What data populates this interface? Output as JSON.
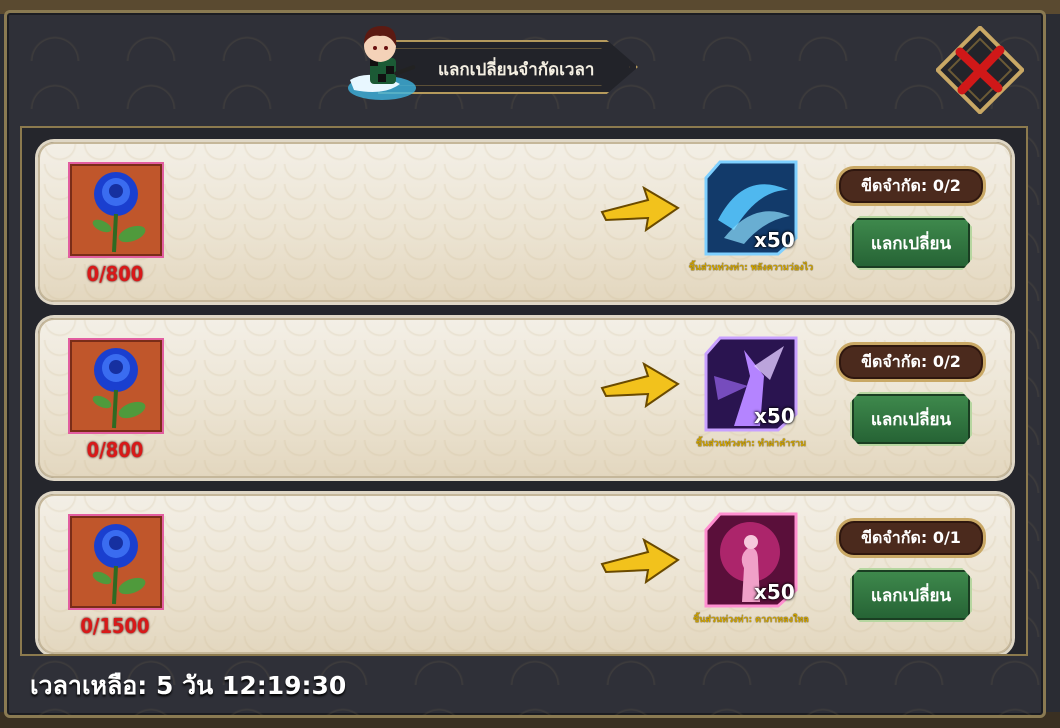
{
  "header": {
    "title": "แลกเปลี่ยนจำกัดเวลา",
    "close_icon": "close-x-icon"
  },
  "colors": {
    "accent_gold": "#b59a5c",
    "cost_red": "#d81919",
    "button_green": "#2f7a3f"
  },
  "exchanges": [
    {
      "cost_item_icon": "blue-rose-icon",
      "cost_count": "0/800",
      "reward_icon": "blue-skill-fragment-icon",
      "reward_qty": "x50",
      "reward_name": "ชิ้นส่วนท่วงท่า: พลังความว่องไว",
      "limit_label": "ขีดจำกัด: 0/2",
      "button_label": "แลกเปลี่ยน"
    },
    {
      "cost_item_icon": "blue-rose-icon",
      "cost_count": "0/800",
      "reward_icon": "purple-skill-fragment-icon",
      "reward_qty": "x50",
      "reward_name": "ชิ้นส่วนท่วงท่า: ทำผ่าคำราม",
      "limit_label": "ขีดจำกัด: 0/2",
      "button_label": "แลกเปลี่ยน"
    },
    {
      "cost_item_icon": "blue-rose-icon",
      "cost_count": "0/1500",
      "reward_icon": "pink-skill-fragment-icon",
      "reward_qty": "x50",
      "reward_name": "ชิ้นส่วนท่วงท่า: ดาภาหลงใหล",
      "limit_label": "ขีดจำกัด: 0/1",
      "button_label": "แลกเปลี่ยน"
    }
  ],
  "footer": {
    "time_left": "เวลาเหลือ: 5 วัน 12:19:30"
  }
}
